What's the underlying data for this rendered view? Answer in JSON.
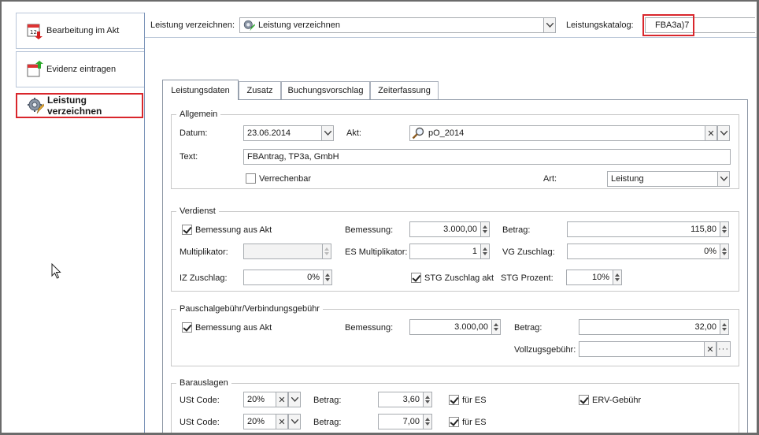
{
  "nav": {
    "items": [
      {
        "label": "Bearbeitung im Akt",
        "icon": "calendar-edit-icon"
      },
      {
        "label": "Evidenz eintragen",
        "icon": "calendar-add-icon"
      },
      {
        "label": "Leistung verzeichnen",
        "icon": "gear-pencil-icon"
      }
    ]
  },
  "top": {
    "action_label": "Leistung verzeichnen:",
    "action_value": "Leistung verzeichnen",
    "katalog_label": "Leistungskatalog:",
    "katalog_value": "FBA3a)7"
  },
  "tabs": [
    "Leistungsdaten",
    "Zusatz",
    "Buchungsvorschlag",
    "Zeiterfassung"
  ],
  "allgemein": {
    "title": "Allgemein",
    "datum_label": "Datum:",
    "datum_value": "23.06.2014",
    "akt_label": "Akt:",
    "akt_value": "pO_2014",
    "text_label": "Text:",
    "text_value": "FBAntrag, TP3a, GmbH",
    "verrechenbar_label": "Verrechenbar",
    "verrechenbar_checked": false,
    "art_label": "Art:",
    "art_value": "Leistung"
  },
  "verdienst": {
    "title": "Verdienst",
    "bemessung_aus_akt_label": "Bemessung aus Akt",
    "bemessung_aus_akt_checked": true,
    "bemessung_label": "Bemessung:",
    "bemessung_value": "3.000,00",
    "betrag_label": "Betrag:",
    "betrag_value": "115,80",
    "multiplikator_label": "Multiplikator:",
    "multiplikator_value": "",
    "es_multiplikator_label": "ES Multiplikator:",
    "es_multiplikator_value": "1",
    "vg_zuschlag_label": "VG Zuschlag:",
    "vg_zuschlag_value": "0%",
    "iz_zuschlag_label": "IZ Zuschlag:",
    "iz_zuschlag_value": "0%",
    "stg_zuschlag_label": "STG Zuschlag akt",
    "stg_zuschlag_checked": true,
    "stg_prozent_label": "STG Prozent:",
    "stg_prozent_value": "10%"
  },
  "pauschal": {
    "title": "Pauschalgebühr/Verbindungsgebühr",
    "bemessung_aus_akt_label": "Bemessung aus Akt",
    "bemessung_aus_akt_checked": true,
    "bemessung_label": "Bemessung:",
    "bemessung_value": "3.000,00",
    "betrag_label": "Betrag:",
    "betrag_value": "32,00",
    "vollzug_label": "Vollzugsgebühr:",
    "vollzug_value": ""
  },
  "barauslagen": {
    "title": "Barauslagen",
    "rows": [
      {
        "ust_label": "USt Code:",
        "ust_value": "20%",
        "betrag_label": "Betrag:",
        "betrag_value": "3,60",
        "fuer_es_label": "für ES",
        "fuer_es_checked": true
      },
      {
        "ust_label": "USt Code:",
        "ust_value": "20%",
        "betrag_label": "Betrag:",
        "betrag_value": "7,00",
        "fuer_es_label": "für ES",
        "fuer_es_checked": true
      }
    ],
    "erv_label": "ERV-Gebühr",
    "erv_checked": true
  },
  "colors": {
    "highlight": "#d9262c",
    "border": "#a7abb0",
    "accent": "#7a93b8"
  }
}
